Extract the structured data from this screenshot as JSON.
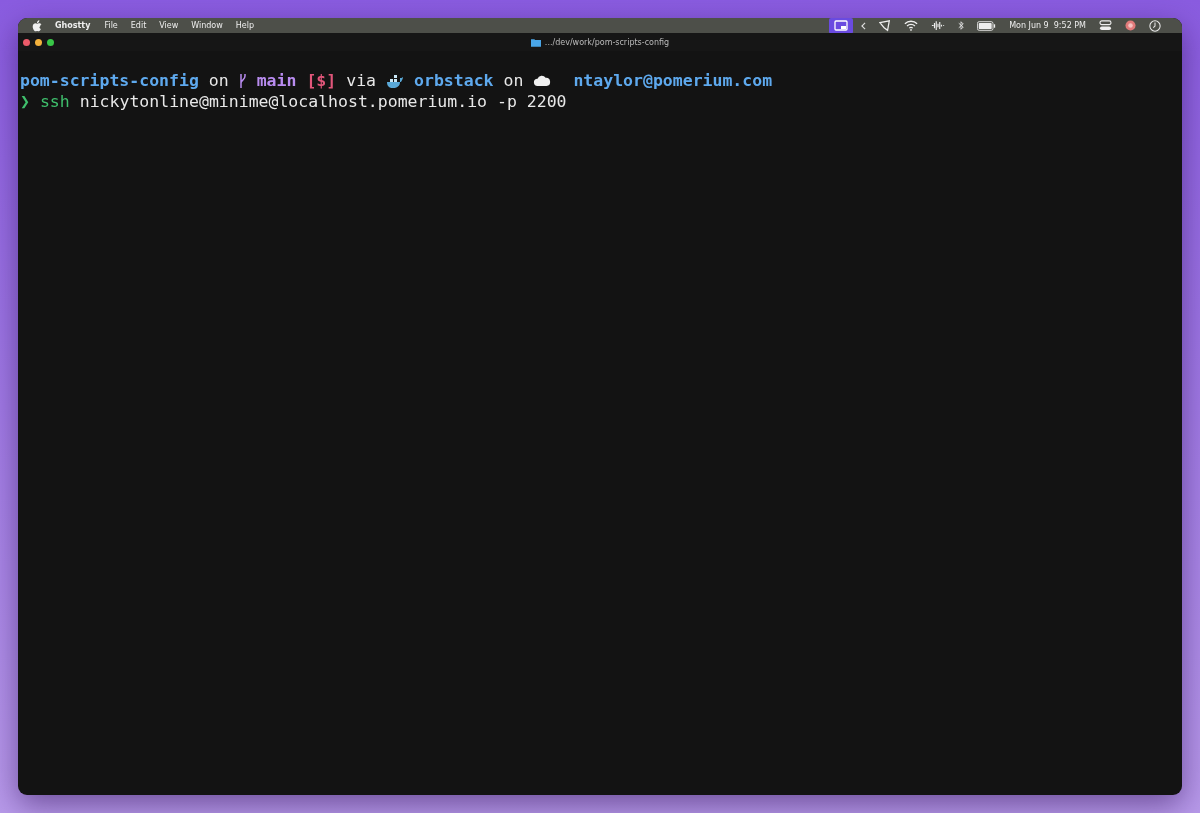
{
  "menu_bar": {
    "app_name": "Ghostty",
    "menus": [
      "File",
      "Edit",
      "View",
      "Window",
      "Help"
    ],
    "clock": "Mon Jun 9  9:52 PM"
  },
  "window": {
    "title": ".../dev/work/pom-scripts-config"
  },
  "terminal": {
    "prompt": {
      "directory": "pom-scripts-config",
      "on_branch": "on",
      "branch": "main",
      "git_status": "[$]",
      "via": "via",
      "context": "orbstack",
      "on_cloud": "on",
      "account": "ntaylor@pomerium.com"
    },
    "command_line": {
      "prompt_symbol": "❯",
      "command": "ssh",
      "arguments": "nickytonline@minime@localhost.pomerium.io -p 2200"
    }
  }
}
